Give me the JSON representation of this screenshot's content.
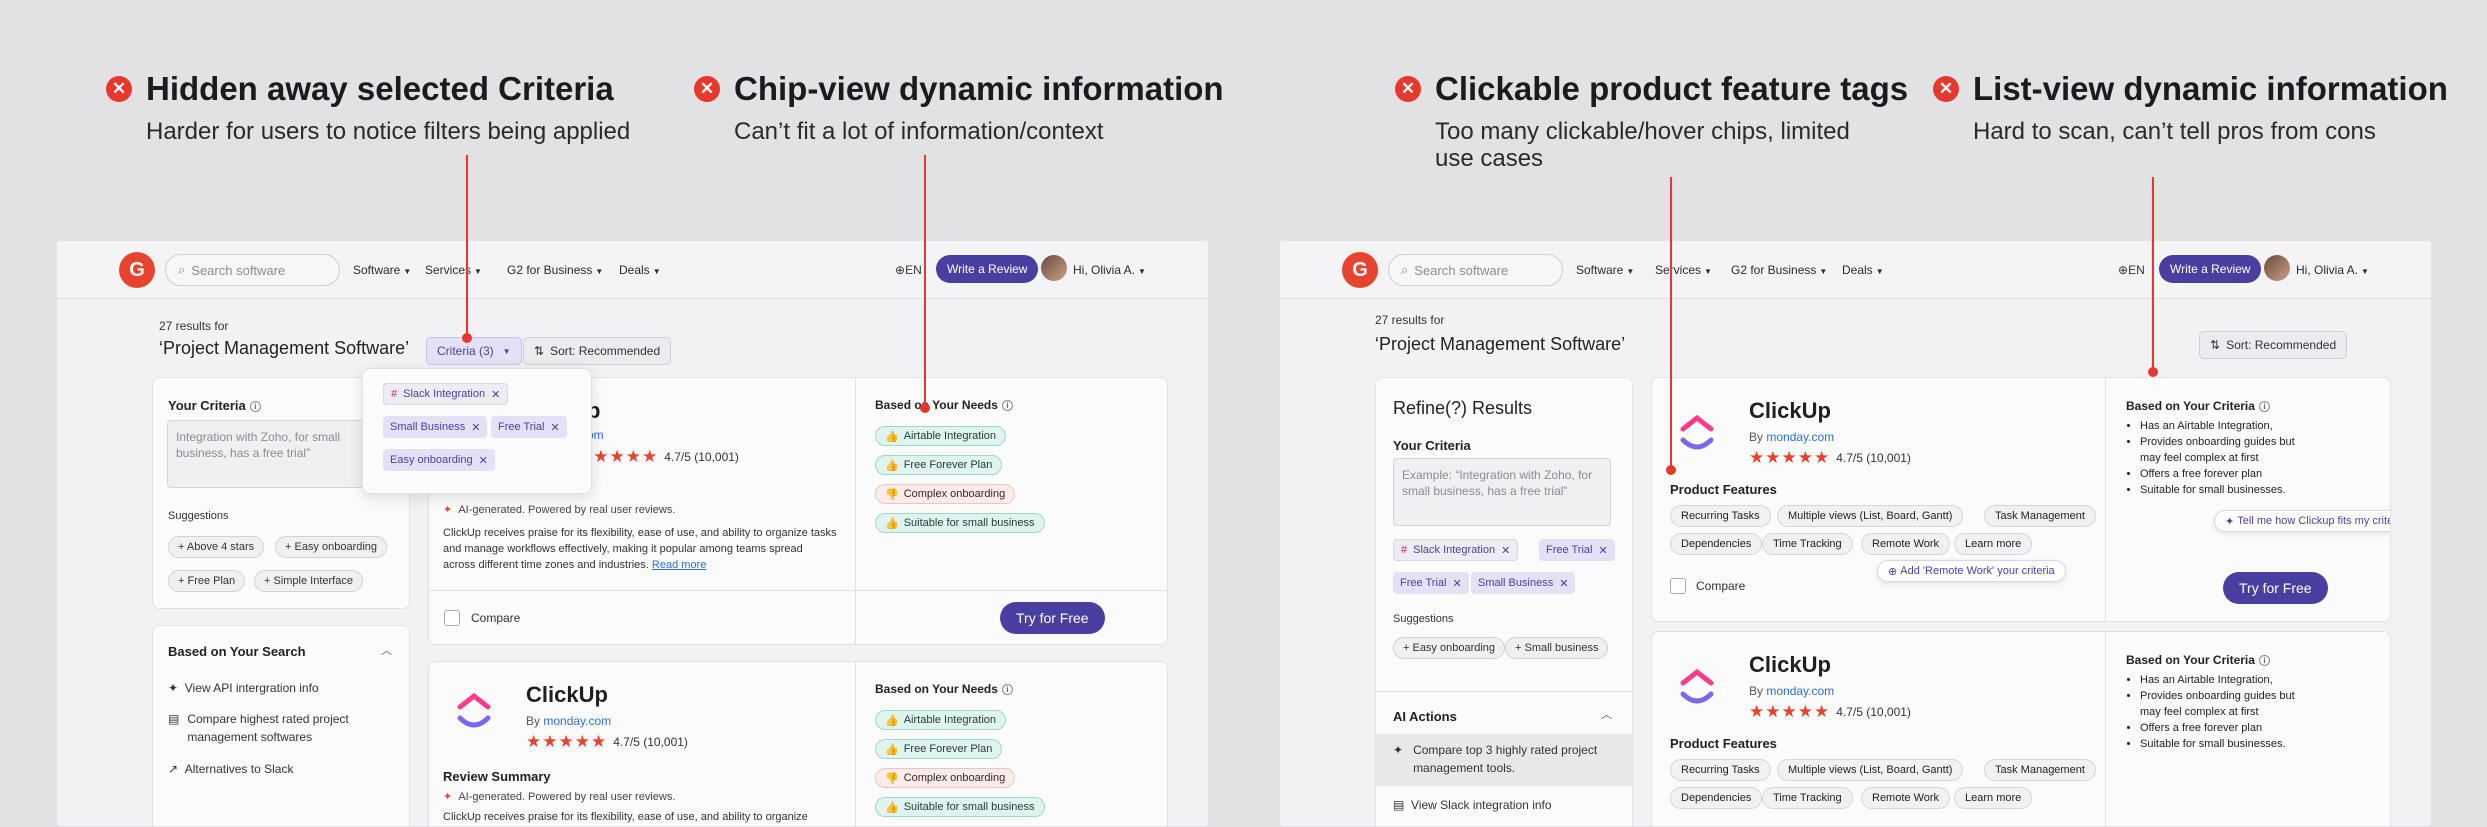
{
  "annotations": [
    {
      "title": "Hidden away selected Criteria",
      "desc": "Harder for users to notice filters being applied"
    },
    {
      "title": "Chip-view dynamic information",
      "desc": "Can’t fit a lot of information/context"
    },
    {
      "title": "Clickable product feature tags",
      "desc": "Too many clickable/hover chips, limited use cases"
    },
    {
      "title": "List-view dynamic information",
      "desc": "Hard to scan, can’t tell pros from cons"
    }
  ],
  "nav": {
    "logo": "G",
    "search_placeholder": "Search software",
    "menu": [
      "Software",
      "Services",
      "G2 for Business",
      "Deals"
    ],
    "lang": "EN",
    "write_review": "Write a Review",
    "user": "Hi, Olivia A."
  },
  "left": {
    "results_count": "27 results for",
    "query": "‘Project Management Software’",
    "criteria_btn": "Criteria (3)",
    "sort_btn": "Sort: Recommended",
    "your_criteria": "Your Criteria",
    "textarea": "Integration with Zoho, for small business, has a free trial”",
    "suggestions_label": "Suggestions",
    "suggestions": [
      "+ Above 4 stars",
      "+ Easy onboarding",
      "+ Free Plan",
      "+ Simple Interface"
    ],
    "popup_chips": [
      "Slack Integration",
      "Small Business",
      "Free Trial",
      "Easy onboarding"
    ],
    "based_on_search": "Based on Your Search",
    "search_items": [
      "View API intergration info",
      "Compare highest rated project management softwares",
      "Alternatives to Slack"
    ],
    "card1": {
      "name_frag": "p",
      "by_frag": "om",
      "rating": "4.7/5 (10,001)",
      "ai_note": "AI-generated. Powered by real user reviews.",
      "summary": "ClickUp receives praise for its flexibility, ease of use, and ability to organize tasks and manage workflows effectively, making it popular among teams spread across different time zones and industries.",
      "read_more": "Read more",
      "compare": "Compare",
      "try": "Try for Free",
      "needs_title": "Based on Your Needs",
      "needs": [
        {
          "label": "Airtable Integration",
          "kind": "pos"
        },
        {
          "label": "Free Forever Plan",
          "kind": "pos"
        },
        {
          "label": "Complex onboarding",
          "kind": "neg"
        },
        {
          "label": "Suitable for small business",
          "kind": "pos"
        }
      ]
    },
    "card2": {
      "name": "ClickUp",
      "by": "By",
      "by_link": "monday.com",
      "rating": "4.7/5 (10,001)",
      "review_summary": "Review Summary",
      "ai_note": "AI-generated. Powered by real user reviews.",
      "summary": "ClickUp receives praise for its flexibility, ease of use, and ability to organize",
      "needs_title": "Based on Your Needs",
      "needs": [
        {
          "label": "Airtable Integration",
          "kind": "pos"
        },
        {
          "label": "Free Forever Plan",
          "kind": "pos"
        },
        {
          "label": "Complex onboarding",
          "kind": "neg"
        },
        {
          "label": "Suitable for small business",
          "kind": "pos"
        }
      ]
    }
  },
  "right": {
    "results_count": "27 results for",
    "query": "‘Project Management Software’",
    "sort_btn": "Sort: Recommended",
    "refine_title": "Refine(?) Results",
    "your_criteria": "Your Criteria",
    "textarea": "Example: “Integration with Zoho, for small business, has a free trial”",
    "criteria_chips": [
      "Slack Integration",
      "Free Trial",
      "Free Trial",
      "Small Business"
    ],
    "suggestions_label": "Suggestions",
    "suggestions": [
      "+ Easy onboarding",
      "+ Small business"
    ],
    "ai_actions": "AI Actions",
    "ai_items": [
      "Compare top 3 highly rated project management tools.",
      "View Slack integration info"
    ],
    "card1": {
      "name": "ClickUp",
      "by": "By",
      "by_link": "monday.com",
      "rating": "4.7/5 (10,001)",
      "features_title": "Product Features",
      "features": [
        "Recurring Tasks",
        "Multiple views (List, Board, Gantt)",
        "Task Management",
        "Dependencies",
        "Time Tracking",
        "Remote Work",
        "Learn more"
      ],
      "add_tip": "Add 'Remote Work' your criteria",
      "compare": "Compare",
      "try": "Try for Free",
      "criteria_title": "Based on Your Criteria",
      "criteria_list": [
        "Has an Airtable Integration,",
        "Provides onboarding guides but may feel complex at first",
        "Offers a free forever plan",
        "Suitable for small businesses."
      ],
      "tell_me": "Tell me how Clickup fits my criteria"
    },
    "card2": {
      "name": "ClickUp",
      "by": "By",
      "by_link": "monday.com",
      "rating": "4.7/5 (10,001)",
      "features_title": "Product Features",
      "features": [
        "Recurring Tasks",
        "Multiple views (List, Board, Gantt)",
        "Task Management",
        "Dependencies",
        "Time Tracking",
        "Remote Work",
        "Learn more"
      ],
      "criteria_title": "Based on Your Criteria",
      "criteria_list": [
        "Has an Airtable Integration,",
        "Provides onboarding guides but may feel complex at first",
        "Offers a free forever plan",
        "Suitable for small businesses."
      ]
    }
  },
  "colors": {
    "accent": "#4a3fa0",
    "alert": "#e8372c",
    "star": "#e8432e",
    "background": "#e2e2e5"
  }
}
